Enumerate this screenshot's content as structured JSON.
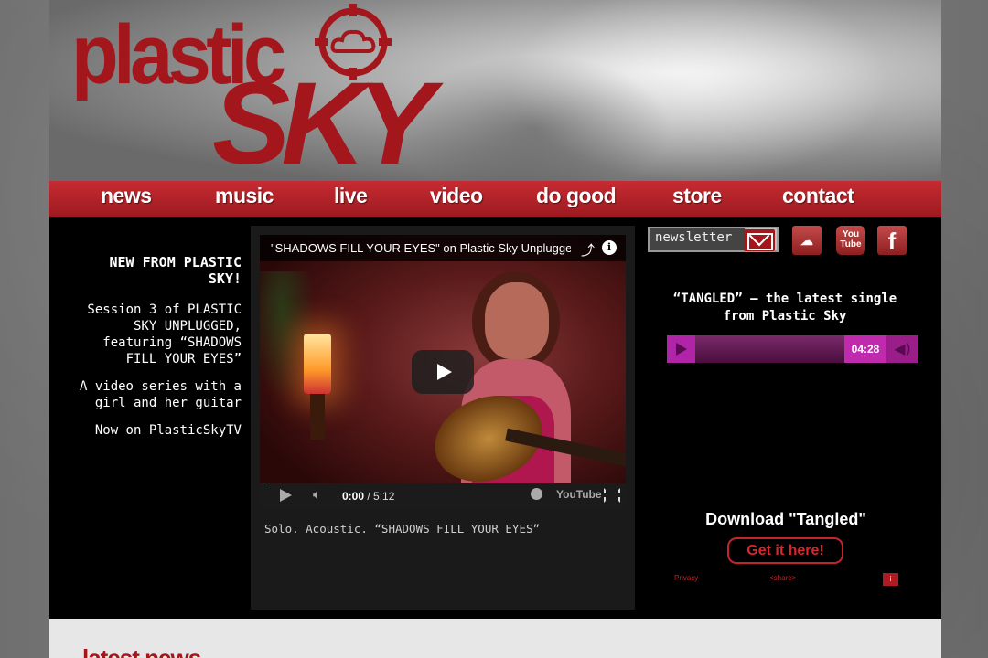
{
  "logo": {
    "word1": "plastic",
    "word2": "SKY"
  },
  "nav": [
    "news",
    "music",
    "live",
    "video",
    "do good",
    "store",
    "contact"
  ],
  "left": {
    "headline": "NEW FROM PLASTIC SKY!",
    "p1": "Session 3 of PLASTIC SKY UNPLUGGED, featuring “SHADOWS FILL YOUR EYES”",
    "p2": "A video series with a girl and her guitar",
    "p3": "Now on PlasticSkyTV"
  },
  "video": {
    "title": "\"SHADOWS FILL YOUR EYES\" on Plastic Sky Unplugged",
    "time_current": "0:00",
    "time_total": "/ 5:12",
    "yt_label": "YouTube",
    "progress": 0,
    "caption": "Solo. Acoustic. “SHADOWS FILL YOUR EYES”"
  },
  "newsletter": {
    "label": "newsletter"
  },
  "social": {
    "soundcloud": "☁",
    "youtube_top": "You",
    "youtube_bottom": "Tube",
    "facebook": "f"
  },
  "single": {
    "title": "“TANGLED” – the latest single from Plastic Sky",
    "time": "04:28"
  },
  "download": {
    "title": "Download \"Tangled\"",
    "button": "Get it here!",
    "privacy": "Privacy",
    "share": "<share>",
    "small": "i"
  },
  "bottom": {
    "heading": "latest news"
  },
  "colors": {
    "brand_red": "#a3161c",
    "nav_red": "#c62b32",
    "player_magenta": "#c02aac"
  }
}
